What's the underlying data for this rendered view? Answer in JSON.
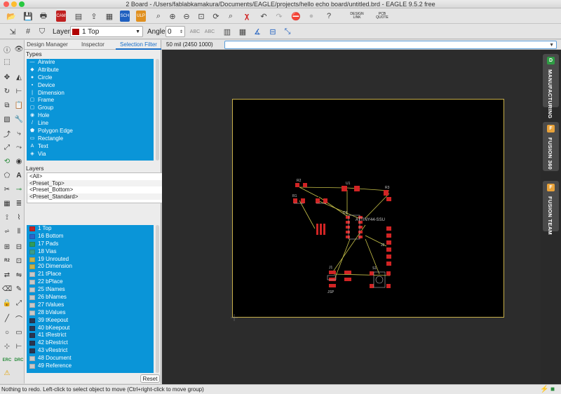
{
  "window": {
    "title": "2 Board - /Users/fablabkamakura/Documents/EAGLE/projects/hello echo board/untitled.brd - EAGLE 9.5.2 free"
  },
  "toolbar": {
    "layer_label": "Layer:",
    "layer_value": "1 Top",
    "layer_color": "#b00000",
    "angle_label": "Angle:",
    "angle_value": "0",
    "design_link": "DESIGN LINK",
    "pcb_quote": "PCB QUOTE",
    "sch_label": "SCH",
    "ulp_label": "ULP",
    "cam_label": "CAM"
  },
  "panel": {
    "tabs": [
      "Design Manager",
      "Inspector",
      "Selection Filter"
    ],
    "types_header": "Types",
    "types": [
      {
        "name": "Airwire",
        "icon": "airwire-icon",
        "glyph": "—"
      },
      {
        "name": "Attribute",
        "icon": "attribute-icon",
        "glyph": "◆"
      },
      {
        "name": "Circle",
        "icon": "circle-icon",
        "glyph": "●"
      },
      {
        "name": "Device",
        "icon": "device-icon",
        "glyph": "▪"
      },
      {
        "name": "Dimension",
        "icon": "dimension-icon",
        "glyph": "|"
      },
      {
        "name": "Frame",
        "icon": "frame-icon",
        "glyph": "▢"
      },
      {
        "name": "Group",
        "icon": "group-icon",
        "glyph": "▢"
      },
      {
        "name": "Hole",
        "icon": "hole-icon",
        "glyph": "◉"
      },
      {
        "name": "Line",
        "icon": "line-icon",
        "glyph": "/"
      },
      {
        "name": "Polygon Edge",
        "icon": "polygon-icon",
        "glyph": "⬟"
      },
      {
        "name": "Rectangle",
        "icon": "rectangle-icon",
        "glyph": "▭"
      },
      {
        "name": "Text",
        "icon": "text-icon",
        "glyph": "A"
      },
      {
        "name": "Via",
        "icon": "via-icon",
        "glyph": "◈"
      }
    ],
    "layers_header": "Layers",
    "presets": [
      "<All>",
      "<Preset_Top>",
      "<Preset_Bottom>",
      "<Preset_Standard>"
    ],
    "layers": [
      {
        "name": "1 Top",
        "color": "#c42424"
      },
      {
        "name": "16 Bottom",
        "color": "#2a64c8"
      },
      {
        "name": "17 Pads",
        "color": "#2f9c5a"
      },
      {
        "name": "18 Vias",
        "color": "#3a9c8c"
      },
      {
        "name": "19 Unrouted",
        "color": "#c9b24a"
      },
      {
        "name": "20 Dimension",
        "color": "#c9b24a"
      },
      {
        "name": "21 tPlace",
        "color": "#c8c8c8"
      },
      {
        "name": "22 bPlace",
        "color": "#c8c8c8"
      },
      {
        "name": "25 tNames",
        "color": "#c8c8c8"
      },
      {
        "name": "26 bNames",
        "color": "#c8c8c8"
      },
      {
        "name": "27 tValues",
        "color": "#c8c8c8"
      },
      {
        "name": "28 bValues",
        "color": "#c8c8c8"
      },
      {
        "name": "39 tKeepout",
        "color": "#2b3550"
      },
      {
        "name": "40 bKeepout",
        "color": "#2b3550"
      },
      {
        "name": "41 tRestrict",
        "color": "#2b3550"
      },
      {
        "name": "42 bRestrict",
        "color": "#2b3550"
      },
      {
        "name": "43 vRestrict",
        "color": "#2b3550"
      },
      {
        "name": "48 Document",
        "color": "#c8c8c8"
      },
      {
        "name": "49 Reference",
        "color": "#c8c8c8"
      }
    ],
    "reset_label": "Reset"
  },
  "canvas": {
    "coords": "50 mil (2450 1000)",
    "chip_label": "ATTINY44-SSU",
    "part_labels": [
      "R2",
      "R1",
      "U1",
      "C1",
      "R3",
      "J1",
      "S1",
      "J2",
      "JSP"
    ]
  },
  "right_tabs": [
    {
      "label": "MANUFACTURING",
      "badge": "D",
      "color": "#2f9c44"
    },
    {
      "label": "FUSION 360",
      "badge": "F",
      "color": "#e8a23a"
    },
    {
      "label": "FUSION TEAM",
      "badge": "F",
      "color": "#e8a23a"
    }
  ],
  "status": {
    "text": "Nothing to redo. Left-click to select object to move (Ctrl+right-click to move group)"
  }
}
